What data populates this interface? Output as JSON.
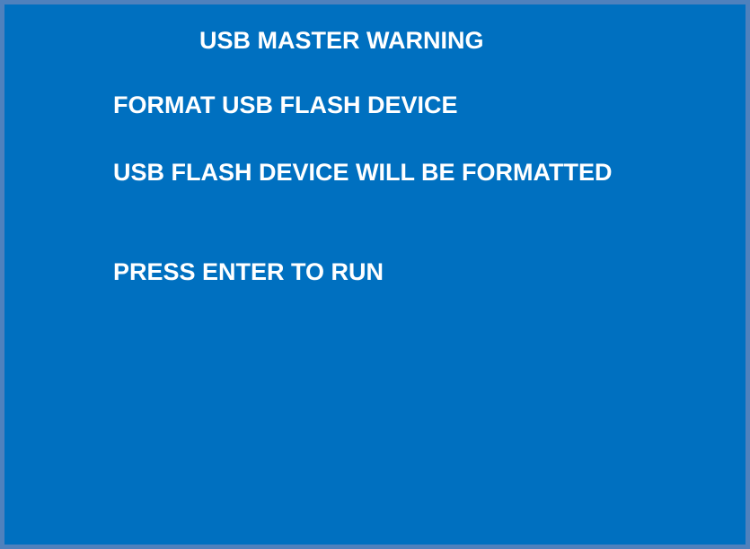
{
  "screen": {
    "title": "USB MASTER WARNING",
    "action": "FORMAT USB FLASH DEVICE",
    "message": "USB FLASH DEVICE WILL BE FORMATTED",
    "prompt": "PRESS ENTER TO RUN"
  },
  "colors": {
    "background": "#0070c0",
    "border": "#4f81bd",
    "text": "#ffffff"
  }
}
